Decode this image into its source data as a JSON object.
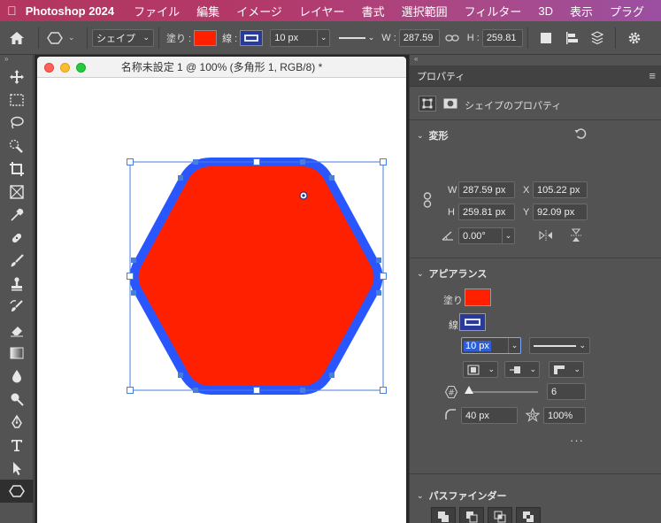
{
  "menubar": {
    "app_name": "Photoshop 2024",
    "items": [
      "ファイル",
      "編集",
      "イメージ",
      "レイヤー",
      "書式",
      "選択範囲",
      "フィルター",
      "3D",
      "表示",
      "プラグ"
    ]
  },
  "optbar": {
    "mode": "シェイプ",
    "fill_label": "塗り :",
    "stroke_label": "線 :",
    "stroke_width": "10 px",
    "w_label": "W :",
    "w_value": "287.59",
    "h_label": "H :",
    "h_value": "259.81"
  },
  "document": {
    "title": "名称未設定 1 @ 100% (多角形 1, RGB/8) *"
  },
  "properties": {
    "tab_label": "プロパティ",
    "kind_label": "シェイプのプロパティ",
    "transform": {
      "title": "変形",
      "w_label": "W",
      "w_value": "287.59 px",
      "x_label": "X",
      "x_value": "105.22 px",
      "h_label": "H",
      "h_value": "259.81 px",
      "y_label": "Y",
      "y_value": "92.09 px",
      "angle_value": "0.00°"
    },
    "appearance": {
      "title": "アピアランス",
      "fill_label": "塗り",
      "stroke_label": "線",
      "stroke_width": "10 px",
      "sides_value": "6",
      "radius_value": "40 px",
      "star_ratio": "100%",
      "more": "···"
    },
    "pathfinder": {
      "title": "パスファインダー"
    }
  },
  "colors": {
    "fill": "#ff2000",
    "stroke": "#2a56ff",
    "selection": "#4a7fd8"
  }
}
